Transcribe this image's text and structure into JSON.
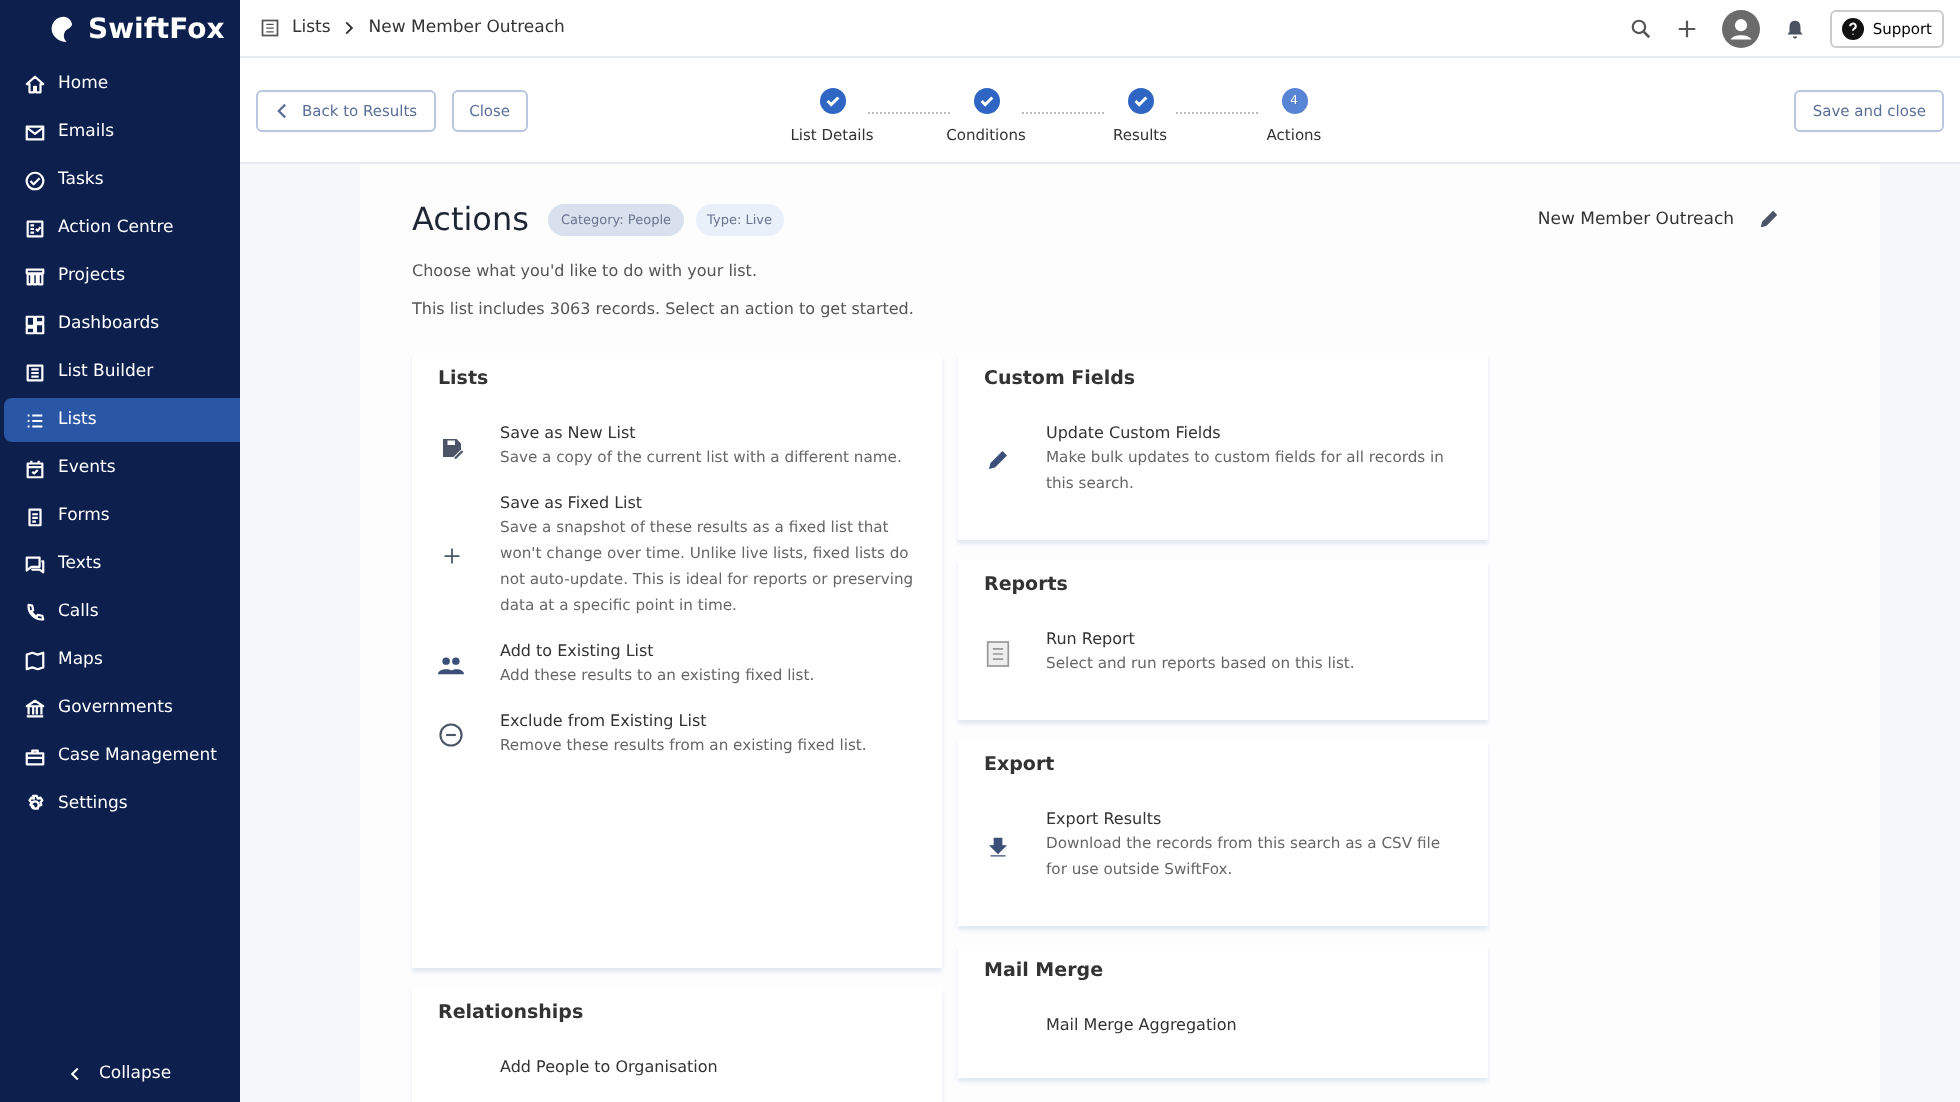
{
  "brand": {
    "name": "SwiftFox"
  },
  "sidebar": {
    "items": [
      {
        "label": "Home",
        "selected": false
      },
      {
        "label": "Emails",
        "selected": false
      },
      {
        "label": "Tasks",
        "selected": false
      },
      {
        "label": "Action Centre",
        "selected": false
      },
      {
        "label": "Projects",
        "selected": false
      },
      {
        "label": "Dashboards",
        "selected": false
      },
      {
        "label": "List Builder",
        "selected": false
      },
      {
        "label": "Lists",
        "selected": true
      },
      {
        "label": "Events",
        "selected": false
      },
      {
        "label": "Forms",
        "selected": false
      },
      {
        "label": "Texts",
        "selected": false
      },
      {
        "label": "Calls",
        "selected": false
      },
      {
        "label": "Maps",
        "selected": false
      },
      {
        "label": "Governments",
        "selected": false
      },
      {
        "label": "Case Management",
        "selected": false
      },
      {
        "label": "Settings",
        "selected": false
      }
    ],
    "collapse": "Collapse"
  },
  "breadcrumb": [
    "Lists",
    "New Member Outreach"
  ],
  "topbar": {
    "support": "Support"
  },
  "toolbar": {
    "back": "Back to Results",
    "close": "Close",
    "save": "Save and close"
  },
  "steps": [
    {
      "label": "List Details",
      "completed": true
    },
    {
      "label": "Conditions",
      "completed": true
    },
    {
      "label": "Results",
      "completed": true
    },
    {
      "label": "Actions",
      "completed": false,
      "number": "4"
    }
  ],
  "page": {
    "title": "Actions",
    "tags": [
      {
        "label": "Category: People",
        "color": "#d9e1ee"
      },
      {
        "label": "Type: Live",
        "color": "#e8f0fa"
      }
    ],
    "list_name": "New Member Outreach",
    "intro": "Choose what you'd like to do with your list.",
    "count_text": "This list includes 3063 records. Select an action to get started."
  },
  "left_sections": [
    {
      "title": "Lists",
      "actions": [
        {
          "kind": "save",
          "title": "Save as New List",
          "text": "Save a copy of the current list with a different name."
        },
        {
          "kind": "plus",
          "title": "Save as Fixed List",
          "text": "Save a snapshot of these results as a fixed list that won't change over time. Unlike live lists, fixed lists do not auto-update. This is ideal for reports or preserving data at a specific point in time."
        },
        {
          "kind": "people",
          "title": "Add to Existing List",
          "text": "Add these results to an existing fixed list."
        },
        {
          "kind": "minus",
          "title": "Exclude from Existing List",
          "text": "Remove these results from an existing fixed list."
        }
      ]
    },
    {
      "title": "Relationships",
      "actions": [
        {
          "kind": "none",
          "title": "Add People to Organisation"
        }
      ]
    }
  ],
  "right_sections": [
    {
      "title": "Custom Fields",
      "actions": [
        {
          "kind": "pencil",
          "title": "Update Custom Fields",
          "text": "Make bulk updates to custom fields for all records in this search."
        }
      ]
    },
    {
      "title": "Reports",
      "actions": [
        {
          "kind": "report",
          "title": "Run Report",
          "text": "Select and run reports based on this list."
        }
      ]
    },
    {
      "title": "Export",
      "actions": [
        {
          "kind": "download",
          "title": "Export Results",
          "text": "Download the records from this search as a CSV file for use outside SwiftFox."
        }
      ]
    },
    {
      "title": "Mail Merge",
      "actions": [
        {
          "kind": "none",
          "title": "Mail Merge Aggregation"
        }
      ]
    }
  ]
}
